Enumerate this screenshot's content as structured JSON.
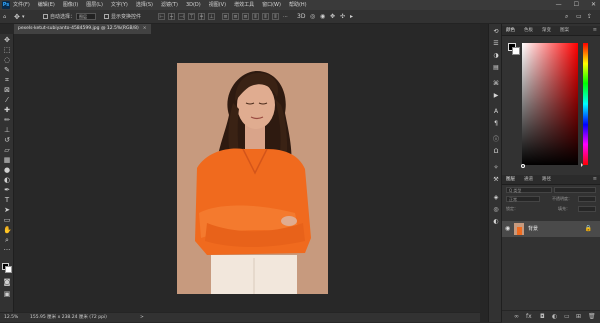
{
  "menubar": {
    "logo": "Ps",
    "items": [
      "文件(F)",
      "编辑(E)",
      "图像(I)",
      "图层(L)",
      "文字(Y)",
      "选择(S)",
      "滤镜(T)",
      "3D(D)",
      "视图(V)",
      "增效工具",
      "窗口(W)",
      "帮助(H)"
    ],
    "window_controls": [
      "—",
      "☐",
      "✕"
    ]
  },
  "options": {
    "auto_select_label": "自动选择：",
    "layer_select_value": "图层",
    "show_transform_label": "显示变换控件"
  },
  "document": {
    "tab_title": "pexels-ketut-subiyanto-4584599.jpg @ 12.5%(RGB/8)",
    "close": "×"
  },
  "status": {
    "zoom": "12.5%",
    "doc_info": "155.95 厘米 x 238.24 厘米 (72 ppi)",
    "arrow": ">"
  },
  "panels": {
    "color_tabs": [
      "颜色",
      "色板",
      "渐变",
      "图案"
    ],
    "layers_tabs": [
      "图层",
      "通道",
      "路径"
    ],
    "layer_kind_placeholder": "Q 类型",
    "blend_mode": "正常",
    "opacity_label": "不透明度：",
    "lock_label": "锁定：",
    "fill_label": "填充：",
    "layer_name": "背景"
  },
  "colors": {
    "foreground": "#000000",
    "background": "#ffffff",
    "accent": "#31a8ff",
    "photo_backdrop": "#c79a7e",
    "shirt": "#f06a1e"
  }
}
